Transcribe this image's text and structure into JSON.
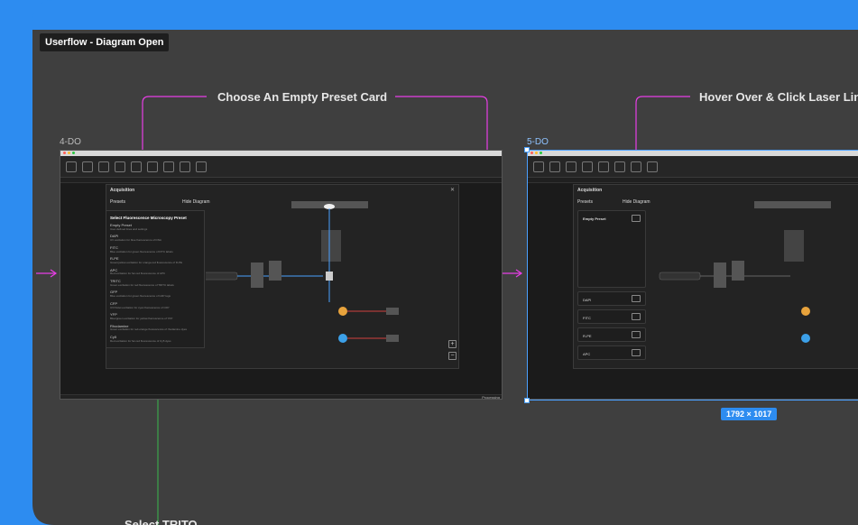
{
  "frame": {
    "title": "Userflow - Diagram Open"
  },
  "annotations": {
    "choose_preset": "Choose An Empty Preset Card",
    "hover_laser": "Hover Over & Click Laser Lin",
    "select_trito": "Select TRITO"
  },
  "sections": {
    "left": "4-DO",
    "right": "5-DO"
  },
  "selection": {
    "dimensions": "1792 × 1017"
  },
  "left_app": {
    "panel_title": "Acquisition",
    "presets_label": "Presets",
    "hide_diagram": "Hide Diagram",
    "dropdown": {
      "heading": "Select Fluorescence Microscopy Preset",
      "items": [
        {
          "name": "Empty Preset",
          "desc": "User-defined lines and settings"
        },
        {
          "name": "DAPI",
          "desc": "UV excitation for blue fluorescence of DNA"
        },
        {
          "name": "FITC",
          "desc": "Blue excitation for green fluorescence of FITC labels"
        },
        {
          "name": "R-PE",
          "desc": "Green/yellow excitation for orange-red fluorescence of R-PE"
        },
        {
          "name": "APC",
          "desc": "Red excitation for far-red fluorescence of APC"
        },
        {
          "name": "TRITC",
          "desc": "Green excitation for red fluorescence of TRITC labels"
        },
        {
          "name": "GFP",
          "desc": "Blue excitation for green fluorescence of GFP tags"
        },
        {
          "name": "CFP",
          "desc": "UV/Violet excitation for cyan fluorescence of CFP"
        },
        {
          "name": "YFP",
          "desc": "Blue/green excitation for yellow fluorescence of YFP"
        },
        {
          "name": "Rhodamine",
          "desc": "Green excitation for red-orange fluorescence of rhodamine dyes"
        },
        {
          "name": "Cy5",
          "desc": "Red excitation for far-red fluorescence of Cy5 dyes"
        }
      ]
    },
    "status": "Processing"
  },
  "right_app": {
    "panel_title": "Acquisition",
    "presets_label": "Presets",
    "hide_diagram": "Hide Diagram",
    "cards": [
      {
        "label": "Empty Preset"
      },
      {
        "label": "DAPI"
      },
      {
        "label": "FITC"
      },
      {
        "label": "R-PE"
      },
      {
        "label": "APC"
      }
    ]
  },
  "colors": {
    "background": "#2d8cf0",
    "annotation_pink": "#e83ee6",
    "annotation_green": "#3ba54a",
    "selection_blue": "#4aa0ff"
  }
}
